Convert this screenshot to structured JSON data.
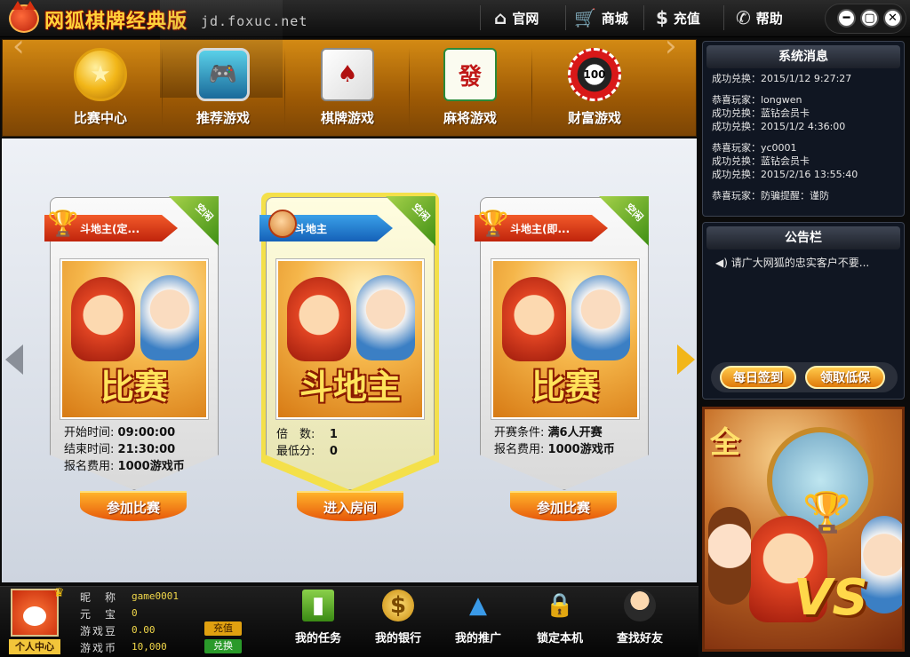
{
  "app": {
    "title": "网狐棋牌经典版",
    "domain": "jd.foxuc.net"
  },
  "topnav": [
    {
      "label": "官网",
      "icon": "home-icon"
    },
    {
      "label": "商城",
      "icon": "cart-icon"
    },
    {
      "label": "充值",
      "icon": "money-bag-icon"
    },
    {
      "label": "帮助",
      "icon": "phone-icon"
    }
  ],
  "categories": [
    {
      "label": "比赛中心",
      "icon": "gold-medal-icon"
    },
    {
      "label": "推荐游戏",
      "icon": "game-controller-icon"
    },
    {
      "label": "棋牌游戏",
      "icon": "cards-chess-icon"
    },
    {
      "label": "麻将游戏",
      "icon": "mahjong-icon",
      "glyph": "發"
    },
    {
      "label": "财富游戏",
      "icon": "chips-icon",
      "glyph": "100"
    }
  ],
  "cards": [
    {
      "title": "斗地主(定...",
      "corner": "空闲",
      "art_text": "比赛",
      "lines": [
        {
          "k": "开始时间:",
          "v": "09:00:00"
        },
        {
          "k": "结束时间:",
          "v": "21:30:00"
        },
        {
          "k": "报名费用:",
          "v": "1000游戏币"
        }
      ],
      "button": "参加比赛"
    },
    {
      "title": "斗地主",
      "corner": "空闲",
      "art_text": "斗地主",
      "lines": [
        {
          "k": "倍　数:",
          "v": "1"
        },
        {
          "k": "最低分:",
          "v": "0"
        }
      ],
      "button": "进入房间"
    },
    {
      "title": "斗地主(即...",
      "corner": "空闲",
      "art_text": "比赛",
      "lines": [
        {
          "k": "开赛条件:",
          "v": "满6人开赛"
        },
        {
          "k": "报名费用:",
          "v": "1000游戏币"
        }
      ],
      "button": "参加比赛"
    }
  ],
  "system_messages": {
    "title": "系统消息",
    "lines": [
      "成功兑换：2015/1/12 9:27:27",
      "",
      "恭喜玩家：longwen",
      "成功兑换：蓝钻会员卡",
      "成功兑换：2015/1/2 4:36:00",
      "",
      "恭喜玩家：yc0001",
      "成功兑换：蓝钻会员卡",
      "成功兑换：2015/2/16 13:55:40",
      "",
      "恭喜玩家：防骗提醒：谨防"
    ]
  },
  "notice": {
    "title": "公告栏",
    "text": "请广大网狐的忠实客户不要...",
    "btn_signin": "每日签到",
    "btn_allowance": "领取低保"
  },
  "user": {
    "center_label": "个人中心",
    "nickname_label": "昵　称",
    "nickname": "game0001",
    "ingot_label": "元　宝",
    "ingot": "0",
    "beans_label": "游戏豆",
    "beans": "0.00",
    "coins_label": "游戏币",
    "coins": "10,000",
    "recharge": "充值",
    "exchange": "兑换"
  },
  "bottom": [
    {
      "label": "我的任务",
      "icon": "task-book-icon"
    },
    {
      "label": "我的银行",
      "icon": "bank-coin-icon"
    },
    {
      "label": "我的推广",
      "icon": "promotion-icon"
    },
    {
      "label": "锁定本机",
      "icon": "lock-icon"
    },
    {
      "label": "查找好友",
      "icon": "find-friend-icon"
    }
  ],
  "banner": {
    "left_text": "全",
    "vs_text": "VS"
  }
}
